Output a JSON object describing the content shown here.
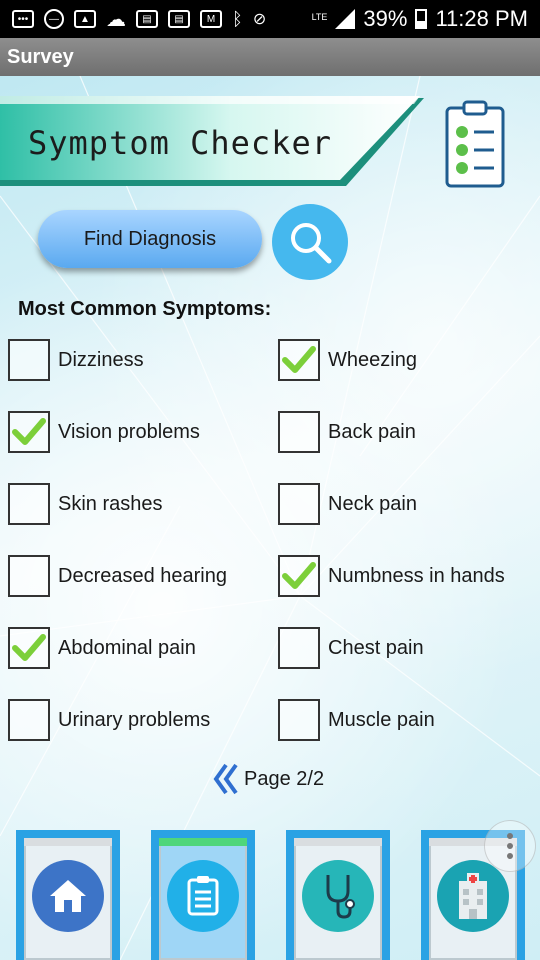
{
  "status_bar": {
    "battery": "39%",
    "time": "11:28 PM",
    "network": "LTE",
    "icons": [
      "messages-icon",
      "do-not-disturb-icon",
      "image-icon",
      "cloud-icon",
      "news-icon",
      "news-icon",
      "gmail-icon",
      "bluetooth-icon",
      "vibrate-icon",
      "signal-icon",
      "battery-icon"
    ]
  },
  "app_bar": {
    "title": "Survey"
  },
  "header": {
    "title": "Symptom Checker",
    "icon": "clipboard-checklist-icon"
  },
  "actions": {
    "find_diagnosis_label": "Find Diagnosis",
    "search_icon": "search-icon"
  },
  "section_title": "Most Common Symptoms:",
  "symptoms": [
    {
      "label": "Dizziness",
      "checked": false
    },
    {
      "label": "Wheezing",
      "checked": true
    },
    {
      "label": "Vision problems",
      "checked": true
    },
    {
      "label": "Back pain",
      "checked": false
    },
    {
      "label": "Skin rashes",
      "checked": false
    },
    {
      "label": "Neck pain",
      "checked": false
    },
    {
      "label": "Decreased hearing",
      "checked": false
    },
    {
      "label": "Numbness in hands",
      "checked": true
    },
    {
      "label": "Abdominal pain",
      "checked": true
    },
    {
      "label": "Chest pain",
      "checked": false
    },
    {
      "label": "Urinary problems",
      "checked": false
    },
    {
      "label": "Muscle pain",
      "checked": false
    }
  ],
  "pager": {
    "label": "Page 2/2",
    "icon": "double-chevron-left-icon"
  },
  "bottom_nav": [
    {
      "icon": "home-icon",
      "active": false
    },
    {
      "icon": "clipboard-list-icon",
      "active": true
    },
    {
      "icon": "stethoscope-icon",
      "active": false
    },
    {
      "icon": "hospital-icon",
      "active": false
    }
  ],
  "colors": {
    "accent": "#2aa2e4",
    "check": "#7ccf3a",
    "banner": "#3fc7b4",
    "active_strip": "#4fd67b"
  }
}
